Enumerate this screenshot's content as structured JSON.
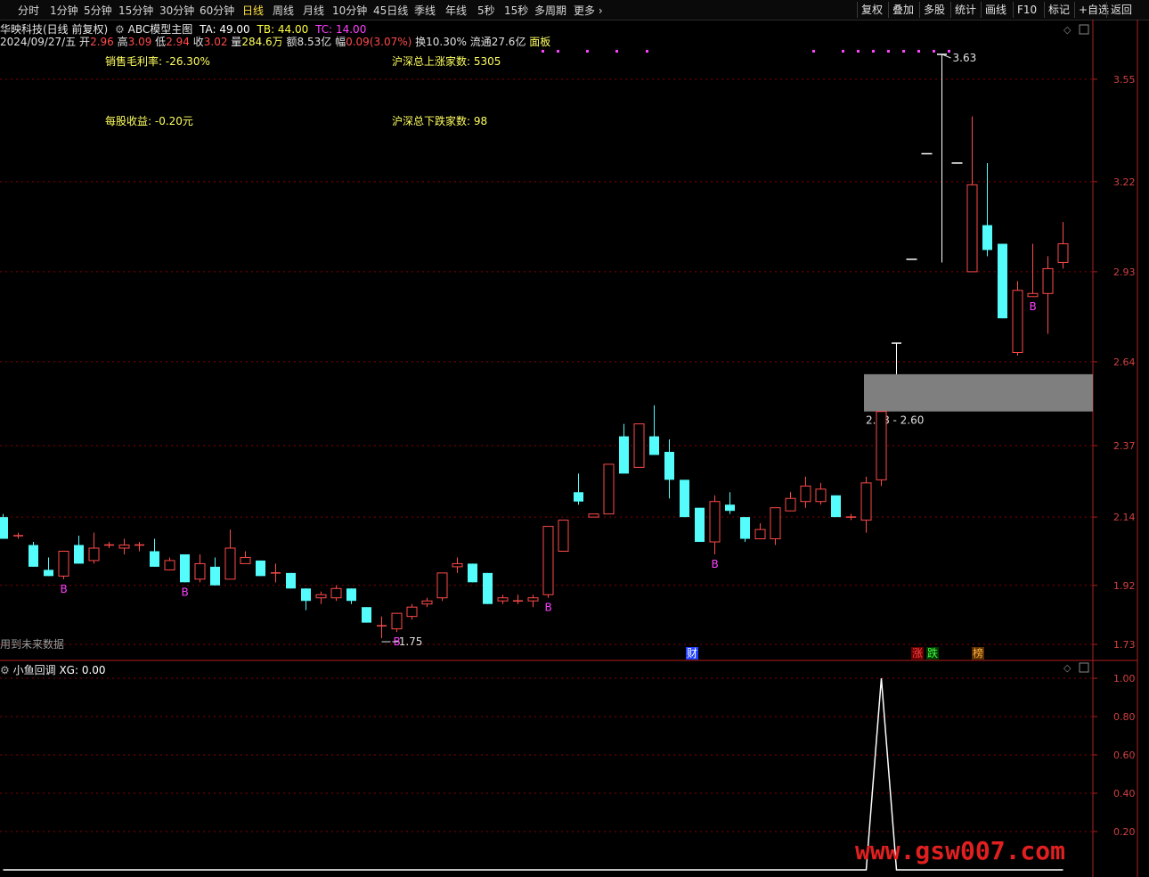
{
  "toolbar": {
    "periods": [
      "分时",
      "1分钟",
      "5分钟",
      "15分钟",
      "30分钟",
      "60分钟",
      "日线",
      "周线",
      "月线",
      "10分钟",
      "45日线",
      "季线",
      "年线",
      "5秒",
      "15秒",
      "多周期",
      "更多"
    ],
    "active_index": 6,
    "right_buttons": [
      "复权",
      "叠加",
      "多股",
      "统计",
      "画线",
      "F10",
      "标记",
      "+自选",
      "返回"
    ]
  },
  "title": {
    "stock": "华映科技(日线 前复权)",
    "indicator": "ABC模型主图",
    "ta": "TA: 49.00",
    "tb": "TB: 44.00",
    "tc": "TC: 14.00"
  },
  "quote": {
    "date": "2024/09/27/五",
    "open_label": "开",
    "open": "2.96",
    "high_label": "高",
    "high": "3.09",
    "low_label": "低",
    "low": "2.94",
    "close_label": "收",
    "close": "3.02",
    "vol_label": "量",
    "vol": "284.6万",
    "amt_label": "额",
    "amt": "8.53亿",
    "chg_label": "幅",
    "chg": "0.09(3.07%)",
    "turnover": "换10.30%",
    "float_cap": "流通27.6亿",
    "panel": "面板"
  },
  "fundamentals": {
    "gross_margin": "销售毛利率: -26.30%",
    "eps": "每股收益: -0.20元",
    "up_count": "沪深总上涨家数: 5305",
    "down_count": "沪深总下跌家数: 98"
  },
  "chart_data": {
    "type": "candlestick",
    "y_ticks": [
      3.55,
      3.22,
      2.93,
      2.64,
      2.37,
      2.14,
      1.92,
      1.73
    ],
    "y_range": [
      1.73,
      3.63
    ],
    "annotations": {
      "high_mark": "3.63",
      "low_mark": "1.75",
      "zone": "2.48 - 2.60",
      "zone_range": [
        2.48,
        2.6
      ]
    },
    "signal_label": "B",
    "event_labels": [
      "财",
      "涨",
      "跌",
      "榜"
    ],
    "future_note": "用到未来数据",
    "candles": [
      {
        "o": 2.14,
        "h": 2.15,
        "l": 2.07,
        "c": 2.07
      },
      {
        "o": 2.08,
        "h": 2.09,
        "l": 2.07,
        "c": 2.08
      },
      {
        "o": 2.05,
        "h": 2.06,
        "l": 1.98,
        "c": 1.98
      },
      {
        "o": 1.97,
        "h": 2.01,
        "l": 1.95,
        "c": 1.95
      },
      {
        "o": 1.95,
        "h": 2.03,
        "l": 1.94,
        "c": 2.03
      },
      {
        "o": 2.05,
        "h": 2.08,
        "l": 1.99,
        "c": 1.99
      },
      {
        "o": 2.0,
        "h": 2.09,
        "l": 1.99,
        "c": 2.04
      },
      {
        "o": 2.05,
        "h": 2.06,
        "l": 2.04,
        "c": 2.05
      },
      {
        "o": 2.04,
        "h": 2.07,
        "l": 2.02,
        "c": 2.05
      },
      {
        "o": 2.05,
        "h": 2.06,
        "l": 2.03,
        "c": 2.05
      },
      {
        "o": 2.03,
        "h": 2.07,
        "l": 1.98,
        "c": 1.98
      },
      {
        "o": 1.97,
        "h": 2.01,
        "l": 1.97,
        "c": 2.0
      },
      {
        "o": 2.02,
        "h": 2.02,
        "l": 1.93,
        "c": 1.93
      },
      {
        "o": 1.94,
        "h": 2.02,
        "l": 1.93,
        "c": 1.99
      },
      {
        "o": 1.98,
        "h": 2.01,
        "l": 1.92,
        "c": 1.92
      },
      {
        "o": 1.94,
        "h": 2.1,
        "l": 1.94,
        "c": 2.04
      },
      {
        "o": 1.99,
        "h": 2.03,
        "l": 1.99,
        "c": 2.01
      },
      {
        "o": 2.0,
        "h": 2.0,
        "l": 1.95,
        "c": 1.95
      },
      {
        "o": 1.96,
        "h": 1.99,
        "l": 1.93,
        "c": 1.96
      },
      {
        "o": 1.96,
        "h": 1.96,
        "l": 1.91,
        "c": 1.91
      },
      {
        "o": 1.91,
        "h": 1.91,
        "l": 1.84,
        "c": 1.87
      },
      {
        "o": 1.88,
        "h": 1.9,
        "l": 1.86,
        "c": 1.89
      },
      {
        "o": 1.88,
        "h": 1.92,
        "l": 1.87,
        "c": 1.91
      },
      {
        "o": 1.91,
        "h": 1.91,
        "l": 1.86,
        "c": 1.87
      },
      {
        "o": 1.85,
        "h": 1.85,
        "l": 1.8,
        "c": 1.8
      },
      {
        "o": 1.79,
        "h": 1.82,
        "l": 1.75,
        "c": 1.79
      },
      {
        "o": 1.78,
        "h": 1.83,
        "l": 1.77,
        "c": 1.83
      },
      {
        "o": 1.82,
        "h": 1.86,
        "l": 1.81,
        "c": 1.85
      },
      {
        "o": 1.86,
        "h": 1.88,
        "l": 1.85,
        "c": 1.87
      },
      {
        "o": 1.88,
        "h": 1.96,
        "l": 1.87,
        "c": 1.96
      },
      {
        "o": 1.98,
        "h": 2.01,
        "l": 1.96,
        "c": 1.99
      },
      {
        "o": 1.99,
        "h": 1.99,
        "l": 1.93,
        "c": 1.93
      },
      {
        "o": 1.96,
        "h": 1.96,
        "l": 1.86,
        "c": 1.86
      },
      {
        "o": 1.87,
        "h": 1.89,
        "l": 1.86,
        "c": 1.88
      },
      {
        "o": 1.87,
        "h": 1.89,
        "l": 1.86,
        "c": 1.87
      },
      {
        "o": 1.87,
        "h": 1.89,
        "l": 1.85,
        "c": 1.88
      },
      {
        "o": 1.89,
        "h": 2.11,
        "l": 1.88,
        "c": 2.11
      },
      {
        "o": 2.03,
        "h": 2.13,
        "l": 2.03,
        "c": 2.13
      },
      {
        "o": 2.22,
        "h": 2.28,
        "l": 2.18,
        "c": 2.19
      },
      {
        "o": 2.14,
        "h": 2.15,
        "l": 2.14,
        "c": 2.15
      },
      {
        "o": 2.15,
        "h": 2.31,
        "l": 2.15,
        "c": 2.31
      },
      {
        "o": 2.4,
        "h": 2.44,
        "l": 2.28,
        "c": 2.28
      },
      {
        "o": 2.3,
        "h": 2.44,
        "l": 2.3,
        "c": 2.44
      },
      {
        "o": 2.4,
        "h": 2.5,
        "l": 2.36,
        "c": 2.34
      },
      {
        "o": 2.35,
        "h": 2.39,
        "l": 2.2,
        "c": 2.26
      },
      {
        "o": 2.26,
        "h": 2.26,
        "l": 2.14,
        "c": 2.14
      },
      {
        "o": 2.17,
        "h": 2.17,
        "l": 2.06,
        "c": 2.06
      },
      {
        "o": 2.06,
        "h": 2.21,
        "l": 2.02,
        "c": 2.19
      },
      {
        "o": 2.18,
        "h": 2.22,
        "l": 2.15,
        "c": 2.16
      },
      {
        "o": 2.14,
        "h": 2.14,
        "l": 2.06,
        "c": 2.07
      },
      {
        "o": 2.07,
        "h": 2.12,
        "l": 2.07,
        "c": 2.1
      },
      {
        "o": 2.07,
        "h": 2.17,
        "l": 2.05,
        "c": 2.17
      },
      {
        "o": 2.16,
        "h": 2.22,
        "l": 2.16,
        "c": 2.2
      },
      {
        "o": 2.19,
        "h": 2.27,
        "l": 2.17,
        "c": 2.24
      },
      {
        "o": 2.19,
        "h": 2.25,
        "l": 2.18,
        "c": 2.23
      },
      {
        "o": 2.21,
        "h": 2.21,
        "l": 2.14,
        "c": 2.14
      },
      {
        "o": 2.14,
        "h": 2.15,
        "l": 2.13,
        "c": 2.14
      },
      {
        "o": 2.13,
        "h": 2.27,
        "l": 2.09,
        "c": 2.25
      },
      {
        "o": 2.26,
        "h": 2.48,
        "l": 2.24,
        "c": 2.48
      },
      {
        "o": 2.7,
        "h": 2.7,
        "l": 2.6,
        "c": 2.7
      },
      {
        "o": 2.97,
        "h": 2.97,
        "l": 2.97,
        "c": 2.97
      },
      {
        "o": 3.31,
        "h": 3.31,
        "l": 3.31,
        "c": 3.31
      },
      {
        "o": 3.63,
        "h": 3.63,
        "l": 2.96,
        "c": 3.63
      },
      {
        "o": 3.28,
        "h": 3.28,
        "l": 3.28,
        "c": 3.28
      },
      {
        "o": 2.93,
        "h": 3.43,
        "l": 2.93,
        "c": 3.21
      },
      {
        "o": 3.08,
        "h": 3.28,
        "l": 2.98,
        "c": 3.0
      },
      {
        "o": 3.02,
        "h": 3.02,
        "l": 2.78,
        "c": 2.78
      },
      {
        "o": 2.67,
        "h": 2.9,
        "l": 2.66,
        "c": 2.87
      },
      {
        "o": 2.85,
        "h": 3.02,
        "l": 2.85,
        "c": 2.86
      },
      {
        "o": 2.86,
        "h": 2.98,
        "l": 2.73,
        "c": 2.94
      },
      {
        "o": 2.96,
        "h": 3.09,
        "l": 2.94,
        "c": 3.02
      }
    ],
    "buy_signal_indices": [
      4,
      12,
      26,
      36,
      47,
      68
    ],
    "sub": {
      "title": "小鱼回调",
      "value_text": "XG: 0.00",
      "y_ticks": [
        1.0,
        0.8,
        0.6,
        0.4,
        0.2
      ],
      "spike_index": 58,
      "series_length": 71
    }
  },
  "watermark": "www.gsw007.com",
  "colors": {
    "up": "#ff4a4a",
    "down": "#54fcfc",
    "grid": "#8b0000",
    "zone": "#7f7f7f",
    "signal": "#ff40ff",
    "axis": "#d04040"
  }
}
